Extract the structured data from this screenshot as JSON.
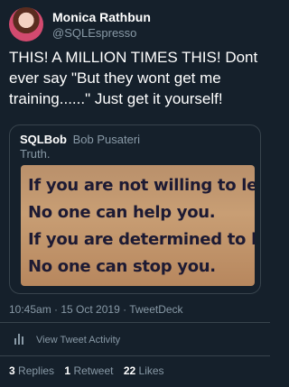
{
  "author": {
    "display_name": "Monica Rathbun",
    "handle": "@SQLEspresso"
  },
  "tweet": {
    "text": "THIS! A MILLION TIMES THIS! Dont ever say \"But they wont get me training......\" Just get it yourself!",
    "timestamp": "10:45am · 15 Oct 2019 · TweetDeck"
  },
  "quoted_tweet": {
    "name": "SQLBob",
    "handle": "Bob Pusateri",
    "text": "Truth.",
    "image_text_lines": [
      "If you are not willing to learn,",
      "No one can help you.",
      "If you are determined to learn,",
      "No one can stop you."
    ]
  },
  "activity": {
    "label": "View Tweet Activity",
    "icon": "bar-chart-icon"
  },
  "stats": {
    "replies_count": "3",
    "replies_label": "Replies",
    "retweets_count": "1",
    "retweets_label": "Retweet",
    "likes_count": "22",
    "likes_label": "Likes"
  },
  "colors": {
    "background": "#15202b",
    "text": "#ffffff",
    "secondary_text": "#8899a6",
    "border": "#38444d"
  }
}
